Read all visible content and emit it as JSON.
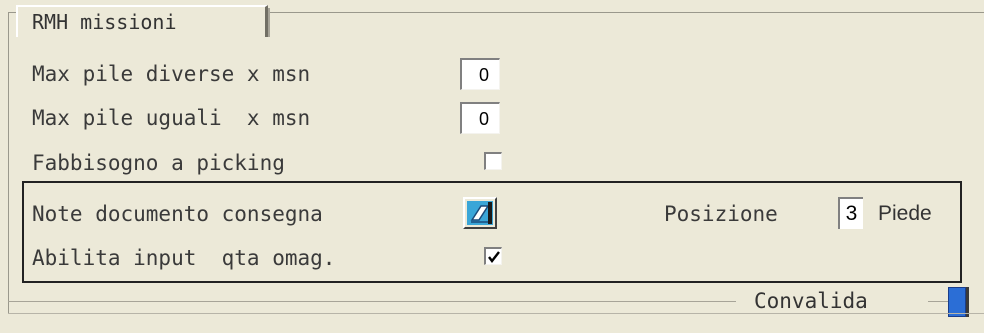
{
  "tab": {
    "label": "RMH missioni"
  },
  "fields": {
    "max_pile_diverse": {
      "label": "Max pile diverse x msn",
      "value": "0"
    },
    "max_pile_uguali": {
      "label": "Max pile uguali  x msn",
      "value": "0"
    },
    "fabbisogno_picking": {
      "label": "Fabbisogno a picking",
      "checked": false
    }
  },
  "group": {
    "note_documento": {
      "label": "Note documento consegna"
    },
    "posizione": {
      "label": "Posizione",
      "value": "3",
      "unit": "Piede"
    },
    "abilita_input": {
      "label": "Abilita input  qta omag.",
      "checked": true
    }
  },
  "footer": {
    "validate_label": "Convalida"
  },
  "colors": {
    "background": "#ece9d8",
    "accent": "#2b6ed6"
  }
}
